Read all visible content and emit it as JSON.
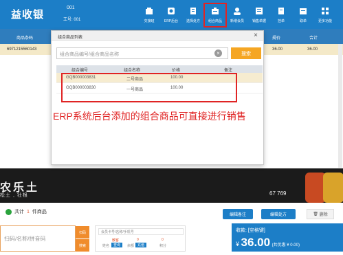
{
  "app": {
    "title": "益收银",
    "terminal_no": "001",
    "worker_label": "工号: 001"
  },
  "toolbar": {
    "items": [
      {
        "label": "交接班",
        "icon": "handover-icon"
      },
      {
        "label": "ERP后台",
        "icon": "erp-icon"
      },
      {
        "label": "选择处方",
        "icon": "prescription-icon"
      },
      {
        "label": "组合商品",
        "icon": "combo-goods-icon"
      },
      {
        "label": "新增会员",
        "icon": "add-member-icon"
      },
      {
        "label": "销售单据",
        "icon": "sales-receipt-icon"
      },
      {
        "label": "挂单",
        "icon": "hold-order-icon"
      },
      {
        "label": "取单",
        "icon": "retrieve-order-icon"
      },
      {
        "label": "更多功能",
        "icon": "more-icon"
      }
    ]
  },
  "table": {
    "headers": {
      "barcode": "商品条码",
      "spec": "规价",
      "total": "合计"
    },
    "rows": [
      {
        "barcode": "6971215560143",
        "spec": "36.00",
        "total": "36.00"
      }
    ]
  },
  "modal": {
    "title": "组合商品列表",
    "close": "×",
    "search_placeholder": "组合商品编号/组合商品名称",
    "search_button": "搜索",
    "columns": [
      "组合编号",
      "组合名称",
      "价格",
      "备注"
    ],
    "rows": [
      {
        "code": "GQB000003831",
        "name": "二号商品",
        "price": "100.00",
        "note": ""
      },
      {
        "code": "GQB000003830",
        "name": "一号商品",
        "price": "100.00",
        "note": ""
      }
    ]
  },
  "annotation": "ERP系统后台添加的组合商品可直接进行销售",
  "banner": {
    "line1": "农乐土",
    "line2": "松土    , 壮根",
    "line3": "67 769"
  },
  "bottom": {
    "total_prefix": "共计",
    "total_count": "1",
    "total_suffix": "件商品",
    "edit_note": "编辑备注",
    "edit_prescription": "编辑处方",
    "delete": "删除",
    "scan_placeholder": "扫码/名称/拼音码",
    "scan_btn1": "扫码",
    "scan_btn2": "搜索",
    "member_placeholder": "会员卡号/名称/手机号",
    "member_fields": {
      "name_label": "姓名",
      "name_value": "散客",
      "balance_label": "余额",
      "balance_value": "0",
      "points_label": "积分",
      "points_value": "0"
    },
    "query_btn": "查询",
    "recharge_btn": "充值",
    "received_label": "收款: [空格键]",
    "currency": "¥",
    "amount": "36.00",
    "discount": "(共优惠 ¥ 0.00)"
  },
  "colors": {
    "primary": "#1c7ec7",
    "accent": "#f5a623",
    "highlight": "#e02424"
  }
}
